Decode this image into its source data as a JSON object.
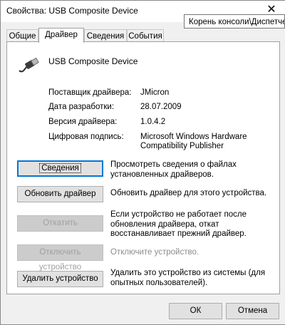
{
  "window": {
    "title": "Свойства: USB Composite Device",
    "close_glyph": "✕",
    "tooltip": "Корень консоли\\Диспетчер устройств"
  },
  "tabs": [
    {
      "label": "Общие",
      "active": false
    },
    {
      "label": "Драйвер",
      "active": true
    },
    {
      "label": "Сведения",
      "active": false
    },
    {
      "label": "События",
      "active": false
    }
  ],
  "device": {
    "icon": "usb-cable-icon",
    "name": "USB Composite Device"
  },
  "properties": [
    {
      "label": "Поставщик драйвера:",
      "value": "JMicron"
    },
    {
      "label": "Дата разработки:",
      "value": "28.07.2009"
    },
    {
      "label": "Версия драйвера:",
      "value": "1.0.4.2"
    },
    {
      "label": "Цифровая подпись:",
      "value_lines": [
        "Microsoft Windows Hardware",
        "Compatibility Publisher"
      ]
    }
  ],
  "actions": [
    {
      "button": "Сведения",
      "description_lines": [
        "Просмотреть сведения о файлах",
        "установленных драйверов."
      ],
      "enabled": true,
      "focused": true
    },
    {
      "button": "Обновить драйвер",
      "description_lines": [
        "Обновить драйвер для этого устройства."
      ],
      "enabled": true
    },
    {
      "button": "Откатить",
      "description_lines": [
        "Если устройство не работает после",
        "обновления драйвера, откат",
        "восстанавливает прежний драйвер."
      ],
      "enabled": false
    },
    {
      "button": "Отключить устройство",
      "description_lines": [
        "Отключите устройство."
      ],
      "enabled": false
    },
    {
      "button": "Удалить устройство",
      "description_lines": [
        "Удалить это устройство из системы (для",
        "опытных пользователей)."
      ],
      "enabled": true
    }
  ],
  "footer": {
    "ok": "ОК",
    "cancel": "Отмена"
  },
  "colors": {
    "focus_border": "#0078d7",
    "disabled_text": "#a0a0a0"
  }
}
